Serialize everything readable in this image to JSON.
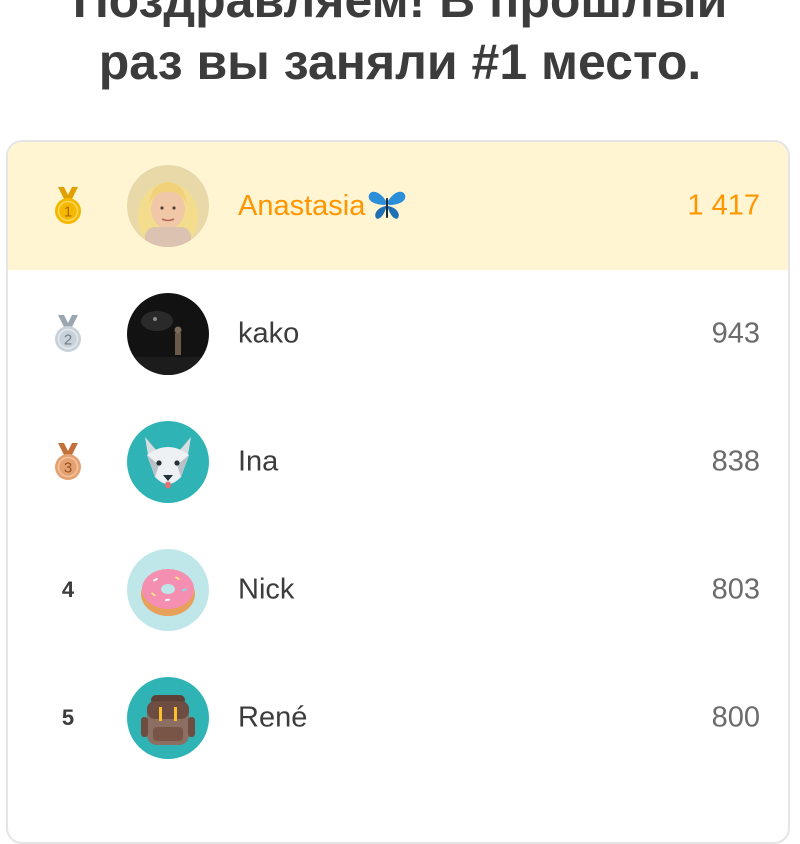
{
  "header": {
    "line1": "Поздравляем! В прошлый",
    "line2": "раз вы заняли #1 место."
  },
  "leaderboard": [
    {
      "rank": "1",
      "name": "Anastasia",
      "score": "1 417",
      "highlight": true,
      "medal": "gold",
      "avatar": "woman-photo-avatar",
      "badge": "butterfly-emoji"
    },
    {
      "rank": "2",
      "name": "kako",
      "score": "943",
      "highlight": false,
      "medal": "silver",
      "avatar": "dark-photo-avatar"
    },
    {
      "rank": "3",
      "name": "Ina",
      "score": "838",
      "highlight": false,
      "medal": "bronze",
      "avatar": "wolf-avatar"
    },
    {
      "rank": "4",
      "name": "Nick",
      "score": "803",
      "highlight": false,
      "medal": null,
      "avatar": "donut-avatar"
    },
    {
      "rank": "5",
      "name": "René",
      "score": "800",
      "highlight": false,
      "medal": null,
      "avatar": "backpack-avatar"
    }
  ],
  "colors": {
    "highlight_bg": "#fff5d3",
    "highlight_text": "#ff9600",
    "gold": "#f5b700",
    "silver": "#b8c3cc",
    "bronze": "#e19a6a",
    "text": "#3c3c3c",
    "score": "#6b6b6b"
  }
}
